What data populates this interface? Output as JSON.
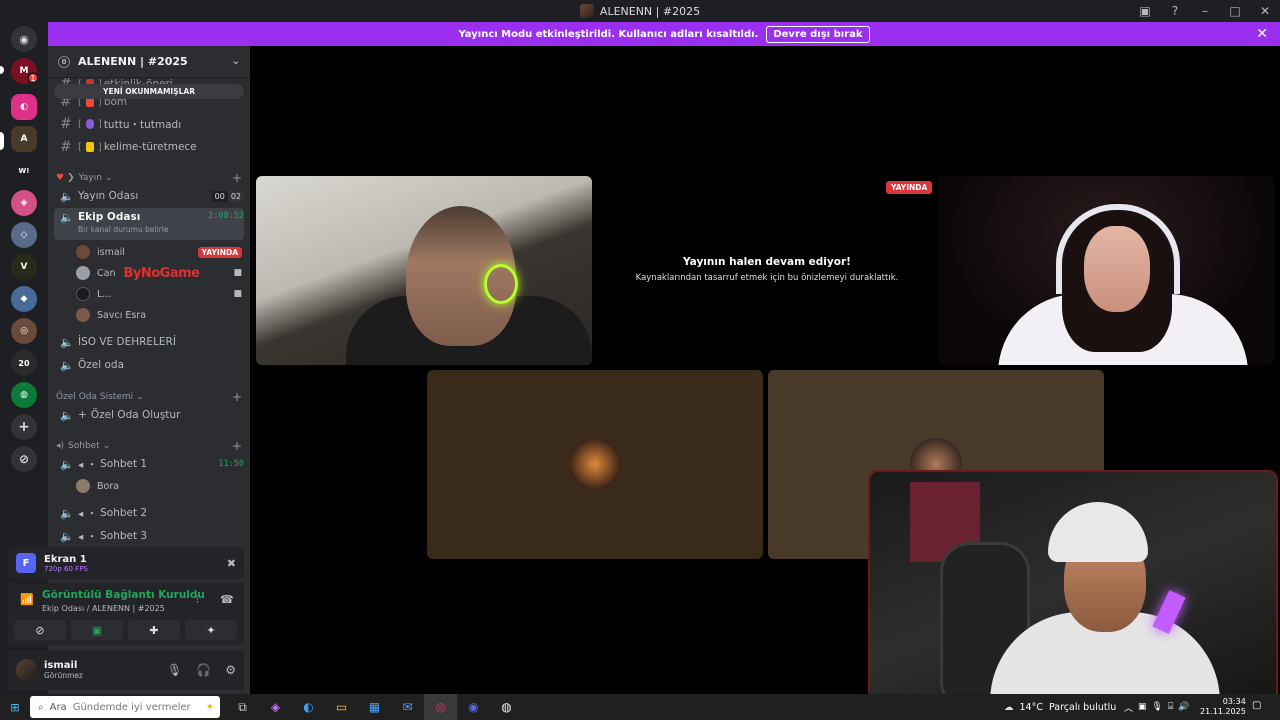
{
  "window": {
    "title": "ALENENN | #2025",
    "controls": [
      "minimize-icon",
      "maximize-icon",
      "close-icon"
    ]
  },
  "banner": {
    "text": "Yayıncı Modu etkinleştirildi. Kullanıcı adları kısaltıldı.",
    "button": "Devre dışı bırak",
    "color": "#9b2ff0"
  },
  "server": {
    "name": "ALENENN | #2025",
    "unread_pill": "YENİ OKUNMAMIŞLAR"
  },
  "text_channels": [
    {
      "name": "etkinlik-öneri"
    },
    {
      "name": "bom"
    },
    {
      "name": "tuttu・tutmadı"
    },
    {
      "name": "kelime-türetmece"
    }
  ],
  "categories": {
    "yayin": "Yayın",
    "ozel_oda_sistemi": "Özel Oda Sistemi",
    "sohbet": "Sohbet"
  },
  "voice_channels": {
    "yayin_odasi": {
      "name": "Yayın Odası",
      "count_a": "00",
      "count_b": "02"
    },
    "ekip_odasi": {
      "name": "Ekip Odası",
      "timer": "2:08:52",
      "status": "Bir kanal durumu belirle"
    },
    "iso": {
      "name": "İSO VE DEHRELERİ"
    },
    "ozel_oda": {
      "name": "Özel oda"
    },
    "ozel_oda_olustur": {
      "name": "Özel Oda Oluştur"
    },
    "sohbet1": {
      "name": "Sohbet 1",
      "timer": "11:50"
    },
    "sohbet2": {
      "name": "Sohbet 2"
    },
    "sohbet3": {
      "name": "Sohbet 3"
    }
  },
  "ekip_members": [
    {
      "name": "ismail",
      "badge": "YAYINDA"
    },
    {
      "name": "Can"
    },
    {
      "name": "L..."
    },
    {
      "name": "Savcı Esra"
    }
  ],
  "watermark": "ByNoGame",
  "sohbet1_members": [
    {
      "name": "Bora"
    }
  ],
  "screen_share": {
    "title": "Ekran 1",
    "quality": "720p 60 FPS"
  },
  "voice_connection": {
    "status": "Görüntülü Bağlantı Kuruldu",
    "location": "Ekip Odası / ALENENN | #2025"
  },
  "user": {
    "name": "ismail",
    "status": "Görünmez"
  },
  "stage": {
    "live_badge": "YAYINDA",
    "paused_title": "Yayının halen devam ediyor!",
    "paused_sub": "Kaynaklarından tasarruf etmek için bu önizlemeyi duraklattık."
  },
  "taskbar": {
    "search_placeholder": "Ara",
    "weather_temp": "14°C",
    "weather_desc": "Parçalı bulutlu",
    "time": "03:34",
    "date": "21.11.2025",
    "bottom_left_text": "Gündemde iyi vermeler"
  }
}
